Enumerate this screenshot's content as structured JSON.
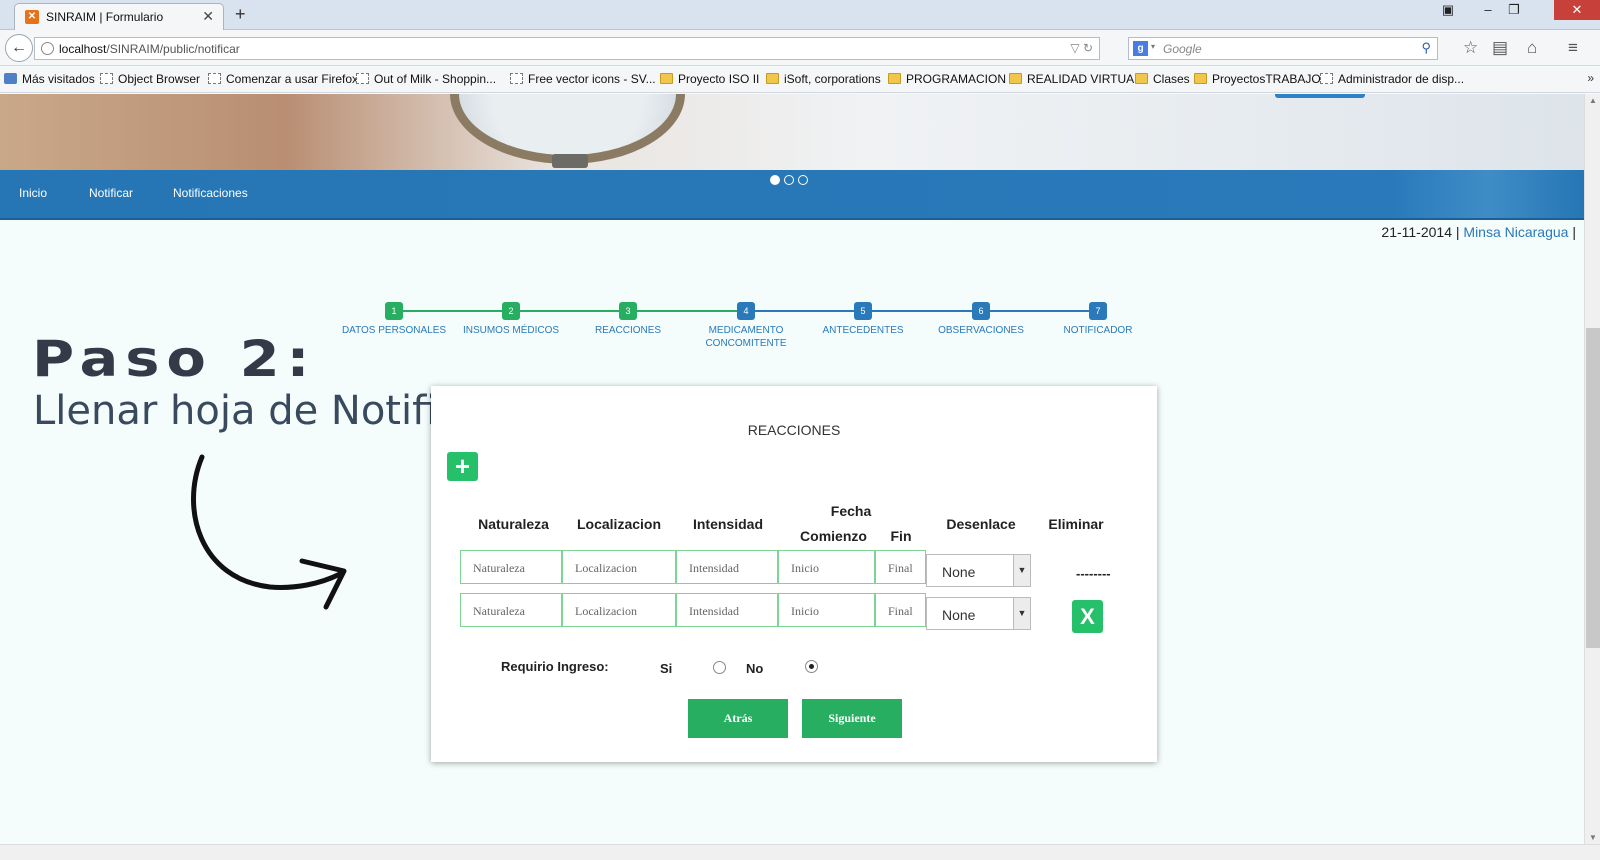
{
  "browser": {
    "tab_title": "SINRAIM | Formulario",
    "url_host": "localhost",
    "url_path": "/SINRAIM/public/notificar",
    "search_placeholder": "Google",
    "bookmarks": [
      {
        "label": "Más visitados",
        "icon": "blue"
      },
      {
        "label": "Object Browser",
        "icon": "page"
      },
      {
        "label": "Comenzar a usar Firefox",
        "icon": "page"
      },
      {
        "label": "Out of Milk - Shoppin...",
        "icon": "page"
      },
      {
        "label": "Free vector icons - SV...",
        "icon": "page"
      },
      {
        "label": "Proyecto ISO II",
        "icon": "folder"
      },
      {
        "label": "iSoft, corporations",
        "icon": "folder"
      },
      {
        "label": "PROGRAMACION",
        "icon": "folder"
      },
      {
        "label": "REALIDAD VIRTUAL",
        "icon": "folder"
      },
      {
        "label": "Clases",
        "icon": "folder"
      },
      {
        "label": "ProyectosTRABAJO",
        "icon": "folder"
      },
      {
        "label": "Administrador de disp...",
        "icon": "page"
      }
    ]
  },
  "nav": {
    "links": [
      "Inicio",
      "Notificar",
      "Notificaciones"
    ]
  },
  "header_info": {
    "date": "21-11-2014",
    "org_link": "Minsa Nicaragua",
    "separator": "|"
  },
  "stepper": {
    "steps": [
      {
        "num": "1",
        "label": "DATOS PERSONALES",
        "state": "done"
      },
      {
        "num": "2",
        "label": "INSUMOS MÉDICOS",
        "state": "done"
      },
      {
        "num": "3",
        "label": "REACCIONES",
        "state": "done"
      },
      {
        "num": "4",
        "label": "MEDICAMENTO CONCOMITENTE",
        "state": "todo"
      },
      {
        "num": "5",
        "label": "ANTECEDENTES",
        "state": "todo"
      },
      {
        "num": "6",
        "label": "OBSERVACIONES",
        "state": "todo"
      },
      {
        "num": "7",
        "label": "NOTIFICADOR",
        "state": "todo"
      }
    ]
  },
  "annotation": {
    "title": "Paso  2:",
    "subtitle": "Llenar hoja de Notificación"
  },
  "form": {
    "title": "REACCIONES",
    "headers": {
      "naturaleza": "Naturaleza",
      "localizacion": "Localizacion",
      "intensidad": "Intensidad",
      "fecha": "Fecha",
      "comienzo": "Comienzo",
      "fin": "Fin",
      "desenlace": "Desenlace",
      "eliminar": "Eliminar"
    },
    "rows": [
      {
        "naturaleza": "Naturaleza",
        "localizacion": "Localizacion",
        "intensidad": "Intensidad",
        "inicio": "Inicio",
        "final": "Final",
        "desenlace": "None"
      },
      {
        "naturaleza": "Naturaleza",
        "localizacion": "Localizacion",
        "intensidad": "Intensidad",
        "inicio": "Inicio",
        "final": "Final",
        "desenlace": "None"
      }
    ],
    "first_row_delete": "--------",
    "delete_icon_label": "X",
    "add_icon_label": "+",
    "requirio_label": "Requirio Ingreso:",
    "si_label": "Si",
    "no_label": "No",
    "selected_option": "No",
    "back_label": "Atrás",
    "next_label": "Siguiente"
  },
  "colors": {
    "nav_blue": "#2676b5",
    "step_green": "#27ae60",
    "step_blue": "#2a7abb",
    "action_green": "#27c06a"
  }
}
